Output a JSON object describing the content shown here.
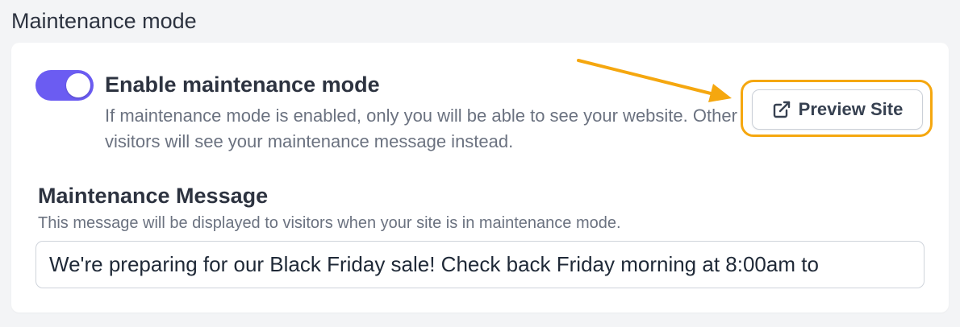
{
  "section": {
    "title": "Maintenance mode"
  },
  "toggle": {
    "label": "Enable maintenance mode",
    "enabled": true,
    "description": "If maintenance mode is enabled, only you will be able to see your website. Other visitors will see your maintenance message instead.",
    "color": "#6b5cf2"
  },
  "preview": {
    "label": "Preview Site",
    "icon": "external-link-icon",
    "highlight_color": "#f5a70f"
  },
  "message": {
    "title": "Maintenance Message",
    "description": "This message will be displayed to visitors when your site is in maintenance mode.",
    "value": "We're preparing for our Black Friday sale! Check back Friday morning at 8:00am to"
  }
}
